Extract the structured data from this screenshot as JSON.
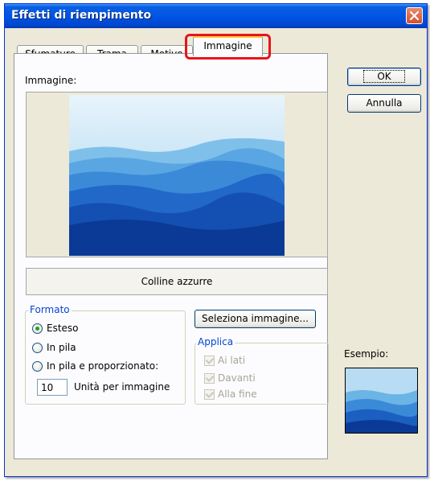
{
  "dialog": {
    "title": "Effetti di riempimento",
    "close_icon": "close-icon"
  },
  "tabs": [
    {
      "label": "Sfumature",
      "active": false
    },
    {
      "label": "Trama",
      "active": false
    },
    {
      "label": "Motivo",
      "active": false
    },
    {
      "label": "Immagine",
      "active": true
    }
  ],
  "image_tab": {
    "image_label": "Immagine:",
    "image_name": "Colline azzurre",
    "select_button": "Seleziona immagine...",
    "format_group": {
      "legend": "Formato",
      "options": [
        {
          "label": "Esteso",
          "checked": true
        },
        {
          "label": "In pila",
          "checked": false
        },
        {
          "label": "In pila e proporzionato:",
          "checked": false
        }
      ],
      "units_value": "10",
      "units_label": "Unità per immagine"
    },
    "apply_group": {
      "legend": "Applica",
      "options": [
        {
          "label": "Ai lati",
          "checked": true,
          "disabled": true
        },
        {
          "label": "Davanti",
          "checked": true,
          "disabled": true
        },
        {
          "label": "Alla fine",
          "checked": true,
          "disabled": true
        }
      ]
    }
  },
  "buttons": {
    "ok": "OK",
    "cancel": "Annulla"
  },
  "sample_label": "Esempio:",
  "colors": {
    "title_bar": "#0055e5",
    "highlight": "#e8141b",
    "group_legend": "#0046d5"
  }
}
